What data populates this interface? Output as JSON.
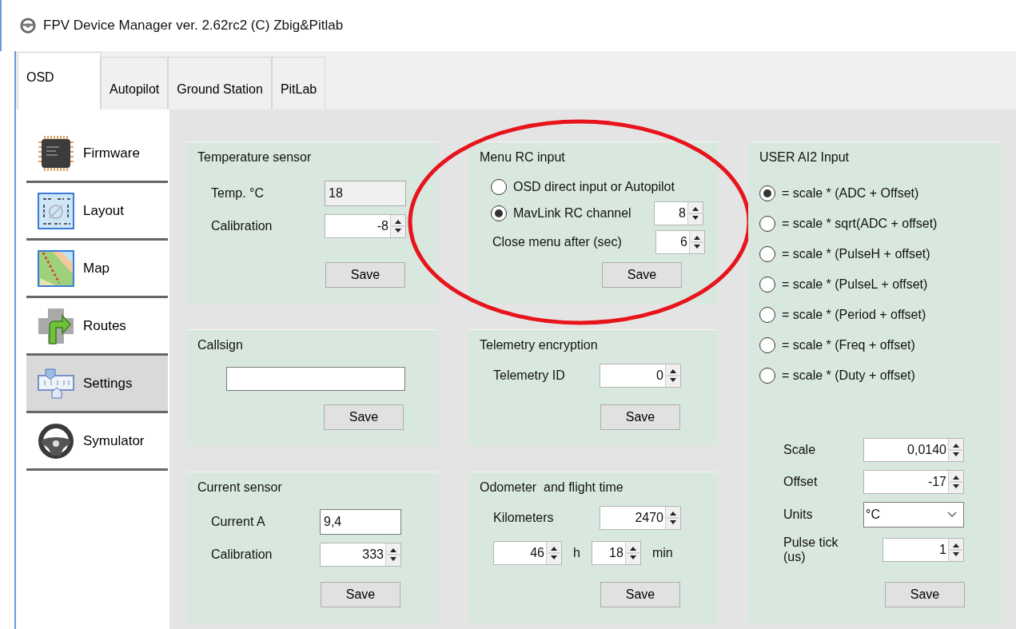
{
  "window": {
    "title": "FPV Device Manager ver. 2.62rc2 (C) Zbig&Pitlab"
  },
  "tabs": [
    {
      "label": "OSD",
      "selected": true
    },
    {
      "label": "Autopilot",
      "selected": false
    },
    {
      "label": "Ground Station",
      "selected": false
    },
    {
      "label": "PitLab",
      "selected": false
    }
  ],
  "sidebar": {
    "items": [
      {
        "label": "Firmware",
        "selected": false
      },
      {
        "label": "Layout",
        "selected": false
      },
      {
        "label": "Map",
        "selected": false
      },
      {
        "label": "Routes",
        "selected": false
      },
      {
        "label": "Settings",
        "selected": true
      },
      {
        "label": "Symulator",
        "selected": false
      }
    ]
  },
  "temperature_sensor": {
    "title": "Temperature sensor",
    "rows": [
      {
        "label": "Temp. °C",
        "value": "18",
        "kind": "readonly"
      },
      {
        "label": "Calibration",
        "value": "-8",
        "kind": "spin"
      }
    ],
    "button": "Save"
  },
  "menu_rc_input": {
    "title": "Menu RC input",
    "highlighted": true,
    "options": [
      {
        "label": "OSD direct input or Autopilot",
        "selected": false
      },
      {
        "label": "MavLink RC channel",
        "selected": true,
        "value": "8"
      }
    ],
    "close_after": {
      "label": "Close menu after (sec)",
      "value": "6"
    },
    "button": "Save"
  },
  "user_ai2_input": {
    "title": "USER AI2 Input",
    "options": [
      {
        "label": "= scale * (ADC + Offset)",
        "selected": true
      },
      {
        "label": "= scale * sqrt(ADC + offset)",
        "selected": false
      },
      {
        "label": "= scale * (PulseH + offset)",
        "selected": false
      },
      {
        "label": "= scale * (PulseL + offset)",
        "selected": false
      },
      {
        "label": "= scale * (Period + offset)",
        "selected": false
      },
      {
        "label": "= scale * (Freq + offset)",
        "selected": false
      },
      {
        "label": "= scale * (Duty + offset)",
        "selected": false
      }
    ],
    "rows": [
      {
        "label": "Scale",
        "value": "0,0140",
        "kind": "spin"
      },
      {
        "label": "Offset",
        "value": "-17",
        "kind": "spin"
      },
      {
        "label": "Units",
        "value": "°C",
        "kind": "combo"
      },
      {
        "label": "Pulse tick (us)",
        "value": "1",
        "kind": "spin"
      }
    ],
    "button": "Save"
  },
  "callsign": {
    "title": "Callsign",
    "button": "Save"
  },
  "telemetry_encryption": {
    "title": "Telemetry encryption",
    "rows": [
      {
        "label": "Telemetry ID",
        "value": "0",
        "kind": "spin"
      }
    ],
    "button": "Save"
  },
  "current_sensor": {
    "title": "Current sensor",
    "rows": [
      {
        "label": "Current A",
        "value": "9,4",
        "kind": "text"
      },
      {
        "label": "Calibration",
        "value": "333",
        "kind": "spin"
      }
    ],
    "button": "Save"
  },
  "odometer": {
    "title": "Odometer  and flight time",
    "rows": [
      {
        "label": "Kilometers",
        "value": "2470",
        "kind": "spin"
      }
    ],
    "hours": {
      "value": "46",
      "unit": "h"
    },
    "minutes": {
      "value": "18",
      "unit": "min"
    },
    "button": "Save"
  }
}
